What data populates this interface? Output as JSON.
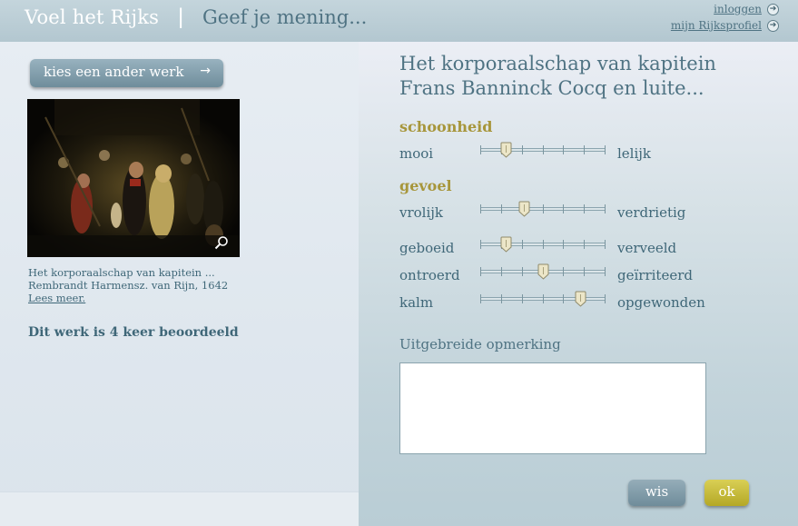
{
  "header": {
    "brand": "Voel het Rijks",
    "separator": "|",
    "subtitle": "Geef je mening...",
    "login_link": "inloggen",
    "profile_link": "mijn Rijksprofiel"
  },
  "left": {
    "other_work_button": "kies een ander werk",
    "painting_alt": "Het korporaalschap van kapitein Frans Banninck Cocq en luite...",
    "caption_title": "Het korporaalschap van kapitein ...",
    "caption_artist": "Rembrandt Harmensz. van Rijn, 1642",
    "read_more": "Lees meer.",
    "rated_text": "Dit werk is 4 keer beoordeeld"
  },
  "main": {
    "work_title_line1": "Het korporaalschap van kapitein",
    "work_title_line2": "Frans Banninck Cocq en luite...",
    "category_beauty": "schoonheid",
    "category_feeling": "gevoel",
    "sliders": [
      {
        "left": "mooi",
        "right": "lelijk",
        "value": 0.2
      },
      {
        "left": "vrolijk",
        "right": "verdrietig",
        "value": 0.35
      },
      {
        "left": "geboeid",
        "right": "verveeld",
        "value": 0.2
      },
      {
        "left": "ontroerd",
        "right": "geïrriteerd",
        "value": 0.5
      },
      {
        "left": "kalm",
        "right": "opgewonden",
        "value": 0.8
      }
    ],
    "remark_label": "Uitgebreide opmerking",
    "remark_value": "",
    "clear_button": "wis",
    "ok_button": "ok"
  },
  "colors": {
    "accent_gold": "#a7963b",
    "text_teal": "#3f6778",
    "button_blue": "#7b97a5",
    "button_gold": "#c5b93a"
  }
}
